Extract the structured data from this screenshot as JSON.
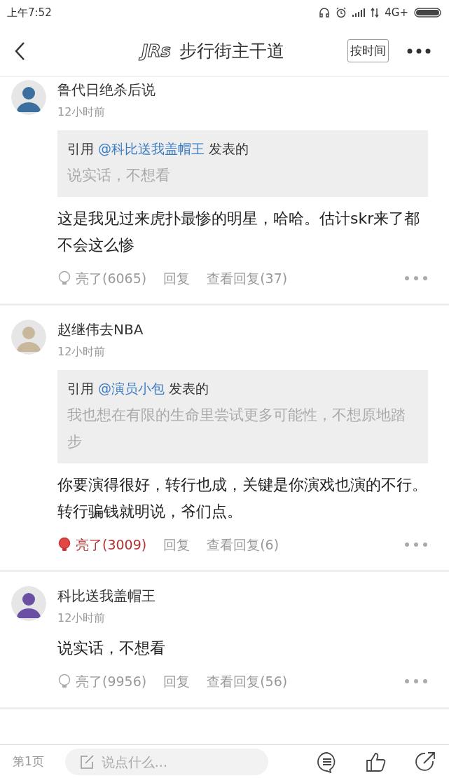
{
  "status_bar": {
    "time": "上午7:52",
    "network": "4G+"
  },
  "header": {
    "logo": "JRs",
    "title": "步行街主干道",
    "sort_button": "按时间"
  },
  "comments": [
    {
      "user": "鲁代日绝杀后说",
      "time": "12小时前",
      "quote": {
        "prefix": "引用",
        "author": "@科比送我盖帽王",
        "suffix": "发表的",
        "text": "说实话，不想看"
      },
      "body": [
        "这是我见过来虎扑最惨的明星，哈哈。估计skr来了都不会这么惨"
      ],
      "light": {
        "label": "亮了(6065)",
        "lit": false
      },
      "reply": "回复",
      "view_replies": "查看回复(37)"
    },
    {
      "user": "赵继伟去NBA",
      "time": "12小时前",
      "quote": {
        "prefix": "引用",
        "author": "@演员小包",
        "suffix": "发表的",
        "text": "我也想在有限的生命里尝试更多可能性，不想原地踏步"
      },
      "body": [
        "你要演得很好，转行也成，关键是你演戏也演的不行。",
        "转行骗钱就明说，爷们点。"
      ],
      "light": {
        "label": "亮了(3009)",
        "lit": true
      },
      "reply": "回复",
      "view_replies": "查看回复(6)"
    },
    {
      "user": "科比送我盖帽王",
      "time": "12小时前",
      "body": [
        "说实话，不想看"
      ],
      "light": {
        "label": "亮了(9956)",
        "lit": false
      },
      "reply": "回复",
      "view_replies": "查看回复(56)"
    }
  ],
  "bottom_bar": {
    "page": "第1页",
    "placeholder": "说点什么..."
  }
}
